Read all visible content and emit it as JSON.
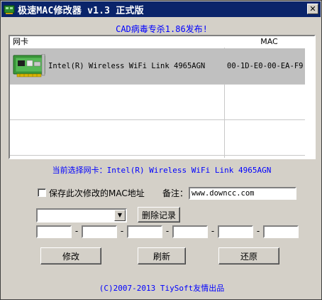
{
  "window": {
    "title": "极速MAC修改器 v1.3 正式版",
    "close_label": "✕"
  },
  "banner": "CAD病毒专杀1.86发布!",
  "adapter_list": {
    "columns": [
      "网卡",
      "MAC"
    ],
    "rows": [
      {
        "name": "Intel(R) Wireless WiFi Link 4965AGN",
        "mac": "00-1D-E0-00-EA-F9",
        "icon": "network-card-icon",
        "selected": true
      }
    ]
  },
  "current_selection": "当前选择网卡：Intel(R) Wireless WiFi Link 4965AGN",
  "save_checkbox": {
    "label": "保存此次修改的MAC地址",
    "checked": false
  },
  "remark": {
    "label": "备注：",
    "value": "www.downcc.com"
  },
  "history_combo": {
    "selected": ""
  },
  "buttons": {
    "delete_record": "删除记录",
    "modify": "修改",
    "refresh": "刷新",
    "restore": "还原"
  },
  "mac_fields": [
    "",
    "",
    "",
    "",
    "",
    ""
  ],
  "mac_separator": "-",
  "footer": "(C)2007-2013 TiySoft友情出品",
  "colors": {
    "titlebar": "#0a246a",
    "accent_text": "#0000ff",
    "face": "#d4d0c8"
  }
}
